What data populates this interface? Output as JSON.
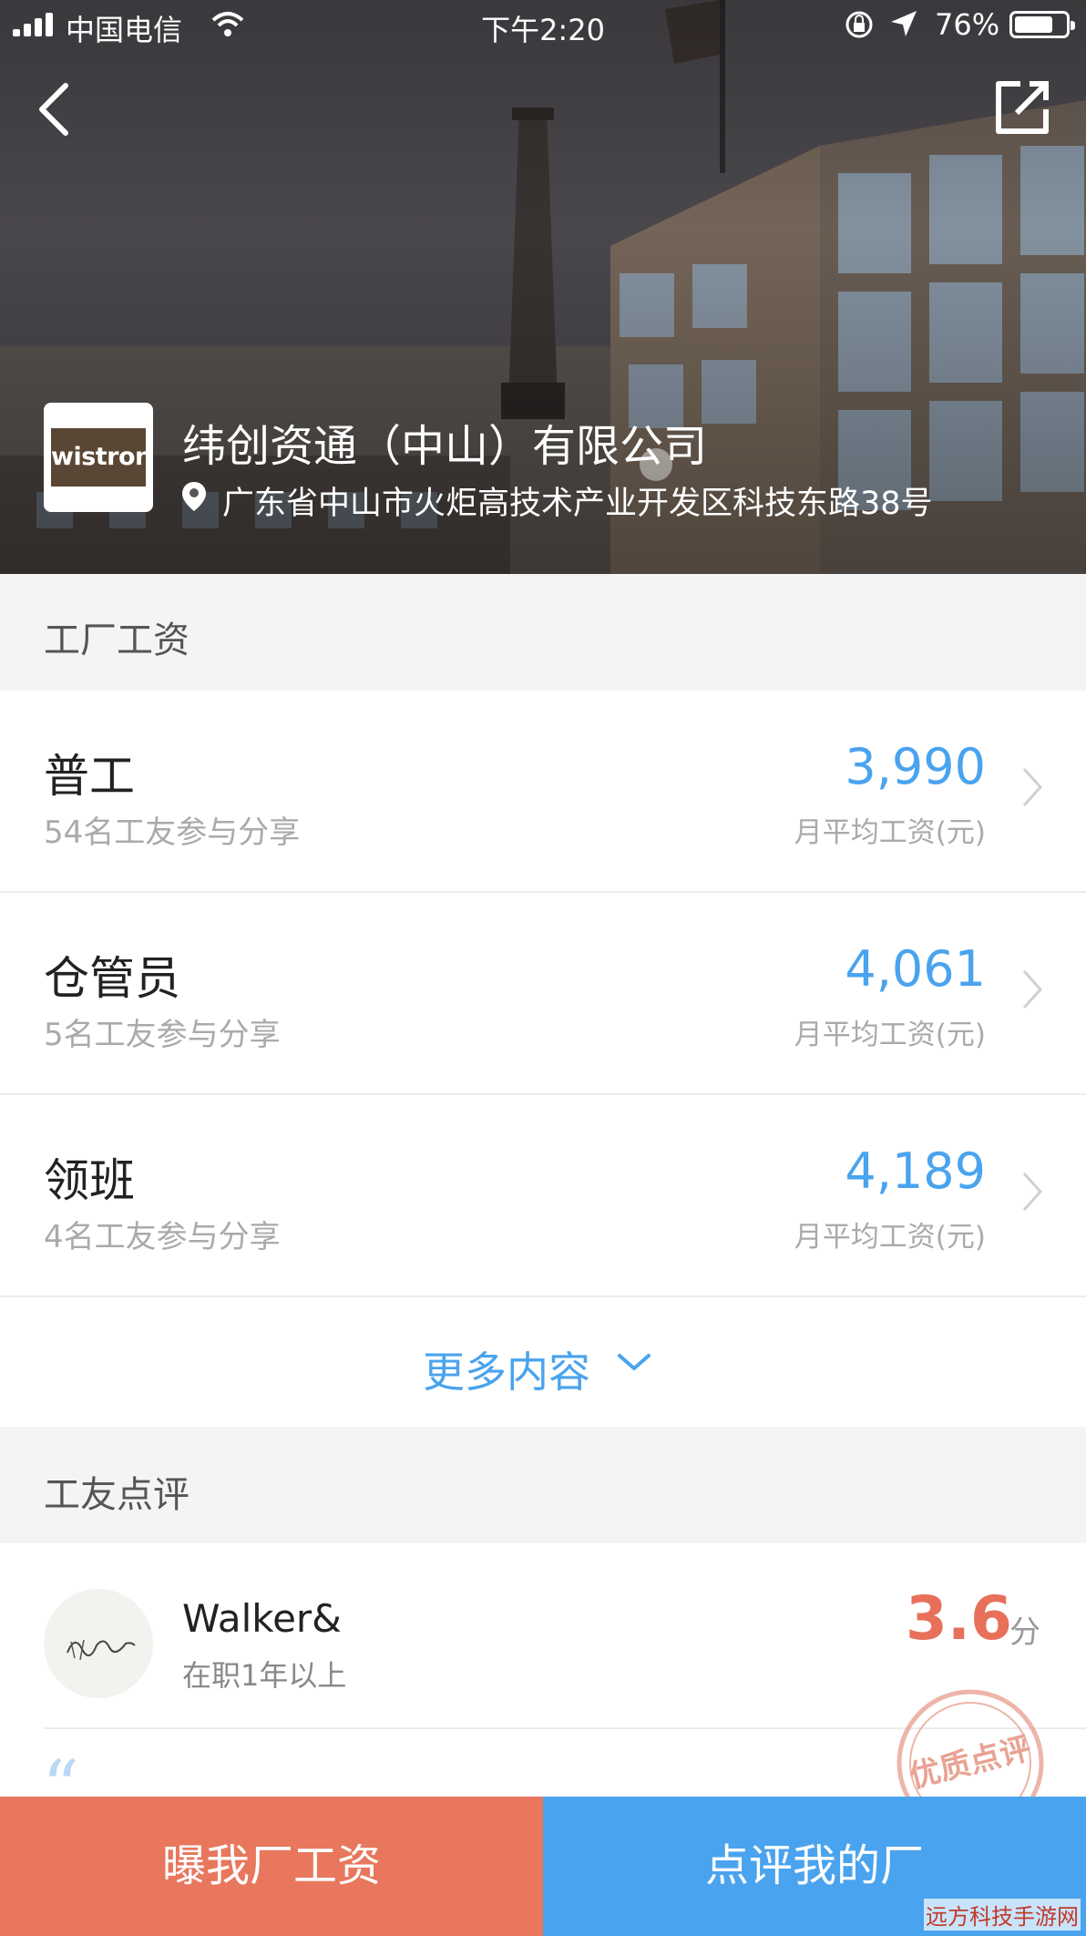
{
  "status_bar": {
    "carrier": "中国电信",
    "time": "下午2:20",
    "battery_pct": "76%",
    "battery_level": 0.76
  },
  "nav": {
    "back_icon": "chevron-left-icon",
    "share_icon": "external-share-icon"
  },
  "company": {
    "logo_text": "wistron",
    "name": "纬创资通（中山）有限公司",
    "address": "广东省中山市火炬高技术产业开发区科技东路38号"
  },
  "salary_section": {
    "title": "工厂工资",
    "items": [
      {
        "job": "普工",
        "participants": "54名工友参与分享",
        "amount": "3,990",
        "unit": "月平均工资(元)"
      },
      {
        "job": "仓管员",
        "participants": "5名工友参与分享",
        "amount": "4,061",
        "unit": "月平均工资(元)"
      },
      {
        "job": "领班",
        "participants": "4名工友参与分享",
        "amount": "4,189",
        "unit": "月平均工资(元)"
      }
    ],
    "more_label": "更多内容"
  },
  "review_section": {
    "title": "工友点评",
    "review": {
      "name": "Walker&",
      "tenure": "在职1年以上",
      "score": "3.6",
      "score_unit": "分",
      "quote": "“",
      "stamp_text": "优质点评"
    }
  },
  "bottom_bar": {
    "salary_button": "曝我厂工资",
    "review_button": "点评我的厂"
  },
  "watermark": "远方科技手游网",
  "colors": {
    "accent_blue": "#4aa3ee",
    "accent_orange": "#e8775d",
    "score_red": "#e8705a"
  }
}
